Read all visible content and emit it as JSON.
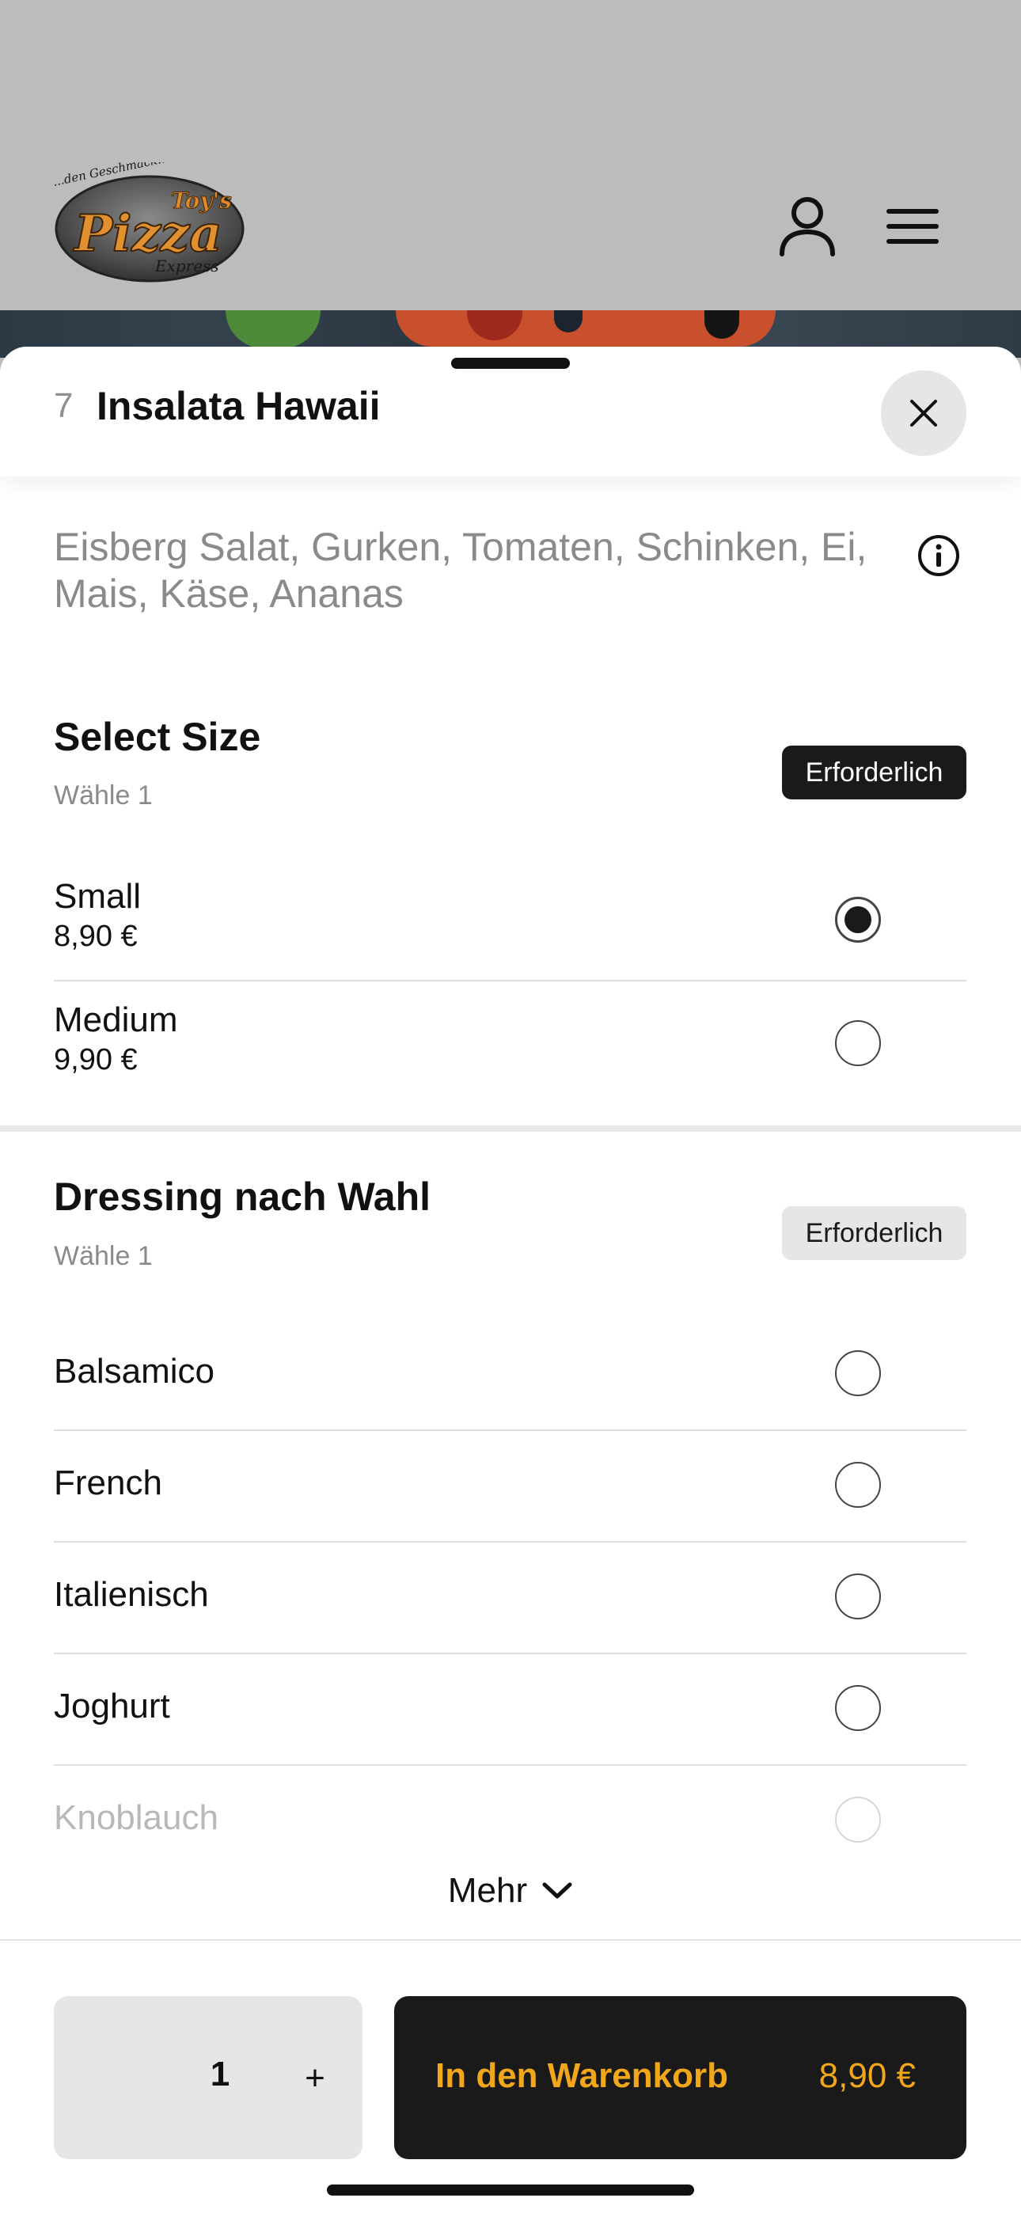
{
  "header": {
    "logo": {
      "script_text": "...den Geschmack...",
      "name_top": "Toy's",
      "name_main": "Pizza",
      "name_sub": "Express"
    },
    "icons": {
      "account": "user-icon",
      "menu": "hamburger-menu-icon"
    }
  },
  "product": {
    "number": "7",
    "title": "Insalata Hawaii",
    "description": "Eisberg Salat, Gurken, Tomaten, Schinken, Ei, Mais, Käse, Ananas",
    "icons": {
      "close": "close-icon",
      "info": "info-icon"
    }
  },
  "size_group": {
    "title": "Select Size",
    "subtitle": "Wähle 1",
    "badge": "Erforderlich",
    "options": [
      {
        "name": "Small",
        "price": "8,90 €",
        "selected": true
      },
      {
        "name": "Medium",
        "price": "9,90 €",
        "selected": false
      }
    ]
  },
  "dressing_group": {
    "title": "Dressing nach Wahl",
    "subtitle": "Wähle 1",
    "badge": "Erforderlich",
    "options": [
      {
        "name": "Balsamico",
        "selected": false
      },
      {
        "name": "French",
        "selected": false
      },
      {
        "name": "Italienisch",
        "selected": false
      },
      {
        "name": "Joghurt",
        "selected": false
      },
      {
        "name": "Knoblauch",
        "selected": false
      }
    ],
    "more_label": "Mehr"
  },
  "footer": {
    "quantity": "1",
    "plus_label": "+",
    "cart_label": "In den Warenkorb",
    "cart_price": "8,90 €"
  },
  "colors": {
    "accent": "#f2a71b",
    "dark": "#1a1a1a",
    "muted_text": "#8a8a8a",
    "header_bg": "#bcbcbc"
  }
}
